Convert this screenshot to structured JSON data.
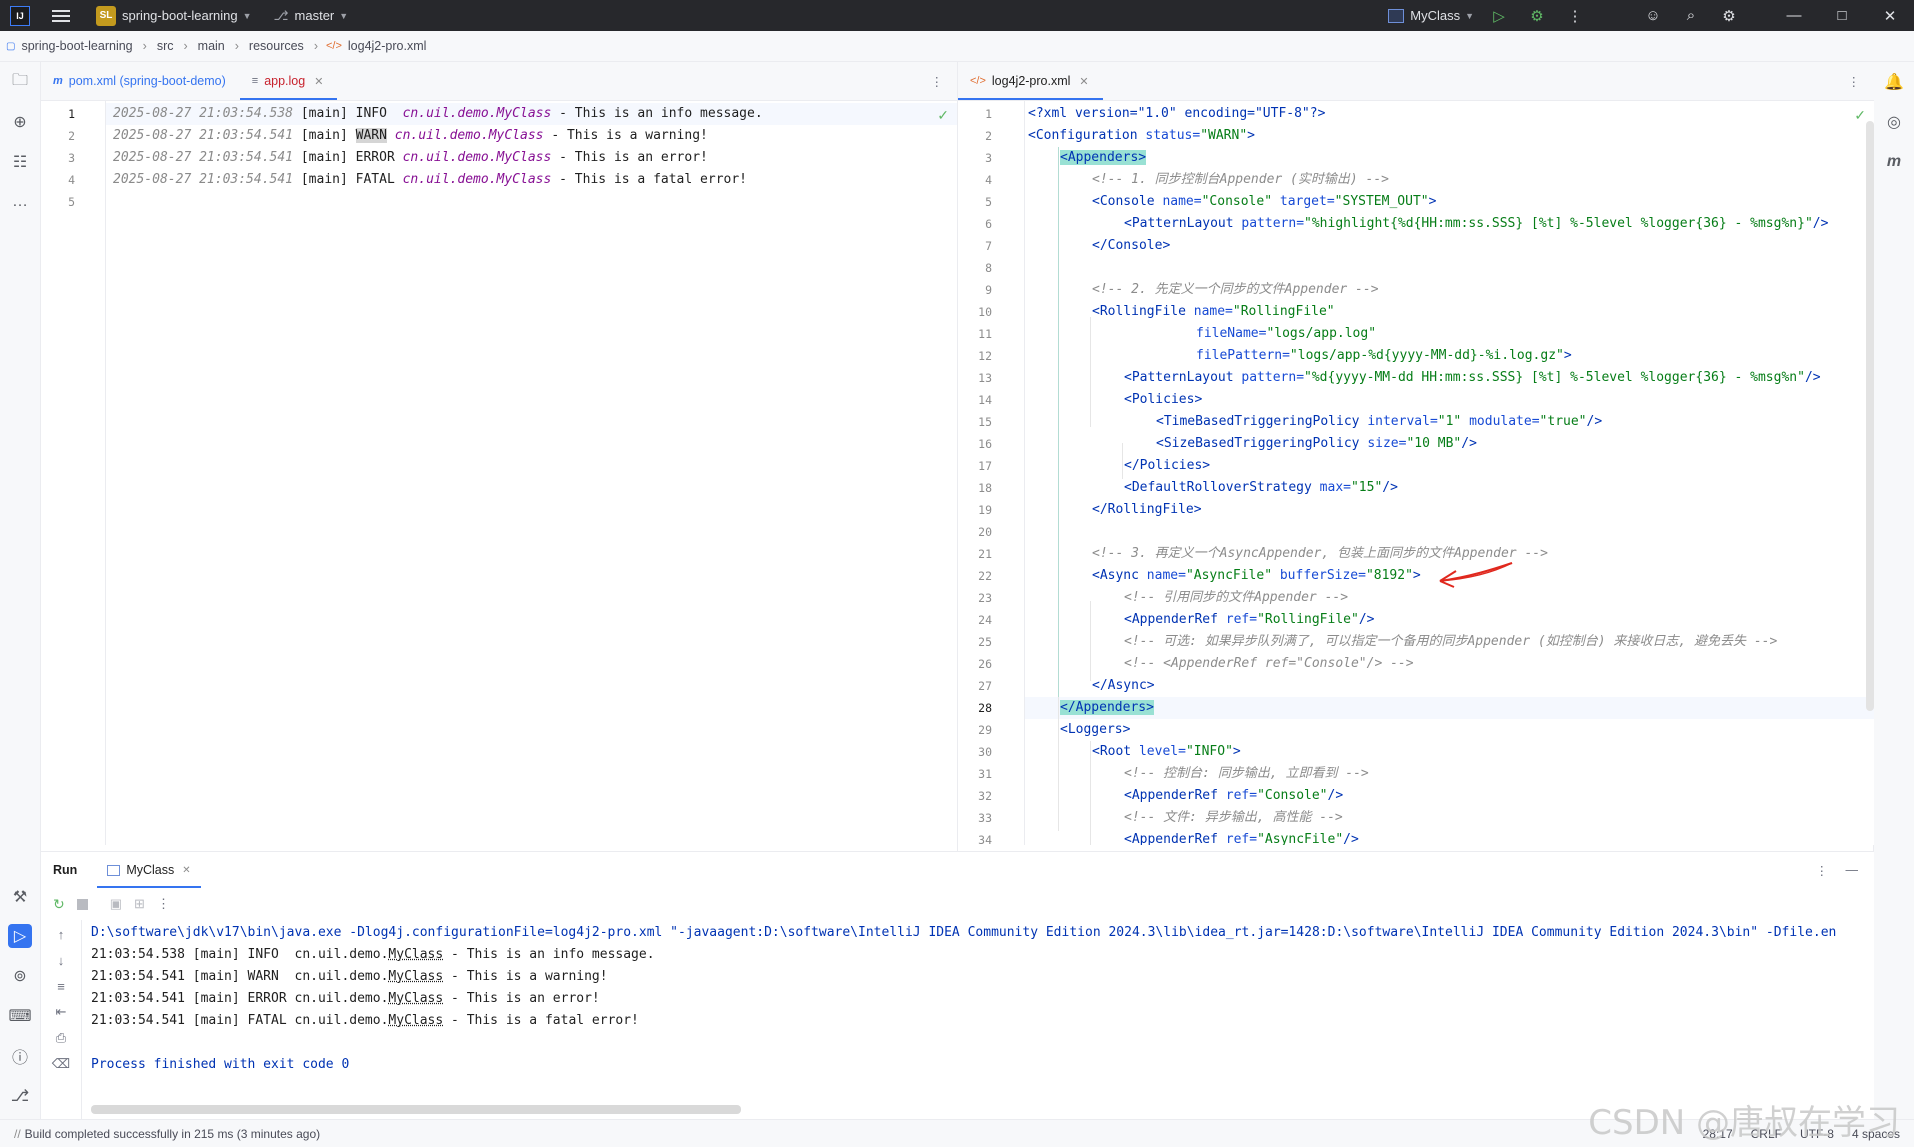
{
  "titlebar": {
    "project_badge": "SL",
    "project_name": "spring-boot-learning",
    "branch": "master",
    "run_config": "MyClass"
  },
  "breadcrumb": [
    "spring-boot-learning",
    "src",
    "main",
    "resources",
    "log4j2-pro.xml"
  ],
  "left_editor": {
    "tabs": [
      {
        "label": "pom.xml (spring-boot-demo)",
        "active": false
      },
      {
        "label": "app.log",
        "active": true
      }
    ],
    "line_numbers": [
      "1",
      "2",
      "3",
      "4",
      "5"
    ],
    "lines": [
      {
        "ts": "2025-08-27 21:03:54.538",
        "thread": "[main]",
        "level": "INFO ",
        "cls": "cn.uil.demo.MyClass",
        "msg": " - This is an info message."
      },
      {
        "ts": "2025-08-27 21:03:54.541",
        "thread": "[main]",
        "level": "WARN",
        "cls": "cn.uil.demo.MyClass",
        "msg": " - This is a warning!"
      },
      {
        "ts": "2025-08-27 21:03:54.541",
        "thread": "[main]",
        "level": "ERROR",
        "cls": "cn.uil.demo.MyClass",
        "msg": " - This is an error!"
      },
      {
        "ts": "2025-08-27 21:03:54.541",
        "thread": "[main]",
        "level": "FATAL",
        "cls": "cn.uil.demo.MyClass",
        "msg": " - This is a fatal error!"
      }
    ]
  },
  "right_editor": {
    "tab": "log4j2-pro.xml",
    "line_numbers": [
      "1",
      "2",
      "3",
      "4",
      "5",
      "6",
      "7",
      "8",
      "9",
      "10",
      "11",
      "12",
      "13",
      "14",
      "15",
      "16",
      "17",
      "18",
      "19",
      "20",
      "21",
      "22",
      "23",
      "24",
      "25",
      "26",
      "27",
      "28",
      "29",
      "30",
      "31",
      "32",
      "33",
      "34"
    ],
    "l1": "<?xml version=\"1.0\" encoding=\"UTF-8\"?>",
    "l2_tag": "<Configuration",
    "l2_attr": " status=",
    "l2_val": "\"WARN\"",
    "l2_end": ">",
    "l3": "<Appenders>",
    "l4": "<!-- 1. 同步控制台Appender (实时输出) -->",
    "l5_tag": "<Console",
    "l5_a1": " name=",
    "l5_v1": "\"Console\"",
    "l5_a2": " target=",
    "l5_v2": "\"SYSTEM_OUT\"",
    "l5_end": ">",
    "l6_tag": "<PatternLayout",
    "l6_a": " pattern=",
    "l6_v": "\"%highlight{%d{HH:mm:ss.SSS} [%t] %-5level %logger{36} - %msg%n}\"",
    "l6_end": "/>",
    "l7": "</Console>",
    "l9": "<!-- 2. 先定义一个同步的文件Appender -->",
    "l10_tag": "<RollingFile",
    "l10_a": " name=",
    "l10_v": "\"RollingFile\"",
    "l11_a": "fileName=",
    "l11_v": "\"logs/app.log\"",
    "l12_a": "filePattern=",
    "l12_v": "\"logs/app-%d{yyyy-MM-dd}-%i.log.gz\"",
    "l12_end": ">",
    "l13_tag": "<PatternLayout",
    "l13_a": " pattern=",
    "l13_v": "\"%d{yyyy-MM-dd HH:mm:ss.SSS} [%t] %-5level %logger{36} - %msg%n\"",
    "l13_end": "/>",
    "l14": "<Policies>",
    "l15_tag": "<TimeBasedTriggeringPolicy",
    "l15_a1": " interval=",
    "l15_v1": "\"1\"",
    "l15_a2": " modulate=",
    "l15_v2": "\"true\"",
    "l15_end": "/>",
    "l16_tag": "<SizeBasedTriggeringPolicy",
    "l16_a": " size=",
    "l16_v": "\"10 MB\"",
    "l16_end": "/>",
    "l17": "</Policies>",
    "l18_tag": "<DefaultRolloverStrategy",
    "l18_a": " max=",
    "l18_v": "\"15\"",
    "l18_end": "/>",
    "l19": "</RollingFile>",
    "l21": "<!-- 3. 再定义一个AsyncAppender, 包装上面同步的文件Appender -->",
    "l22_tag": "<Async",
    "l22_a1": " name=",
    "l22_v1": "\"AsyncFile\"",
    "l22_a2": " bufferSize=",
    "l22_v2": "\"8192\"",
    "l22_end": ">",
    "l23": "<!-- 引用同步的文件Appender -->",
    "l24_tag": "<AppenderRef",
    "l24_a": " ref=",
    "l24_v": "\"RollingFile\"",
    "l24_end": "/>",
    "l25": "<!-- 可选: 如果异步队列满了, 可以指定一个备用的同步Appender (如控制台) 来接收日志, 避免丢失 -->",
    "l26": "<!-- <AppenderRef ref=\"Console\"/> -->",
    "l27": "</Async>",
    "l28": "</Appenders>",
    "l29": "<Loggers>",
    "l30_tag": "<Root",
    "l30_a": " level=",
    "l30_v": "\"INFO\"",
    "l30_end": ">",
    "l31": "<!-- 控制台: 同步输出, 立即看到 -->",
    "l32_tag": "<AppenderRef",
    "l32_a": " ref=",
    "l32_v": "\"Console\"",
    "l32_end": "/>",
    "l33": "<!-- 文件: 异步输出, 高性能 -->",
    "l34_tag": "<AppenderRef",
    "l34_a": " ref=",
    "l34_v": "\"AsyncFile\"",
    "l34_end": "/>"
  },
  "run_panel": {
    "title": "Run",
    "tab": "MyClass",
    "command": "D:\\software\\jdk\\v17\\bin\\java.exe -Dlog4j.configurationFile=log4j2-pro.xml \"-javaagent:D:\\software\\IntelliJ IDEA Community Edition 2024.3\\lib\\idea_rt.jar=1428:D:\\software\\IntelliJ IDEA Community Edition 2024.3\\bin\" -Dfile.en",
    "output": [
      {
        "pre": "21:03:54.538 [main] INFO  cn.uil.demo.",
        "cls": "MyClass",
        "post": " - This is an info message."
      },
      {
        "pre": "21:03:54.541 [main] WARN  cn.uil.demo.",
        "cls": "MyClass",
        "post": " - This is a warning!"
      },
      {
        "pre": "21:03:54.541 [main] ERROR cn.uil.demo.",
        "cls": "MyClass",
        "post": " - This is an error!"
      },
      {
        "pre": "21:03:54.541 [main] FATAL cn.uil.demo.",
        "cls": "MyClass",
        "post": " - This is a fatal error!"
      }
    ],
    "exit": "Process finished with exit code 0"
  },
  "statusbar": {
    "message": "Build completed successfully in 215 ms (3 minutes ago)",
    "position": "28:17",
    "line_sep": "CRLF",
    "encoding": "UTF-8",
    "indent": "4 spaces"
  },
  "watermark": "CSDN @唐叔在学习",
  "colors": {
    "accent": "#3574f0",
    "xml_tag": "#0033b3",
    "xml_string": "#067d17",
    "comment": "#8c8c8c",
    "class": "#871094",
    "matched_tag": "#99e1d4"
  }
}
